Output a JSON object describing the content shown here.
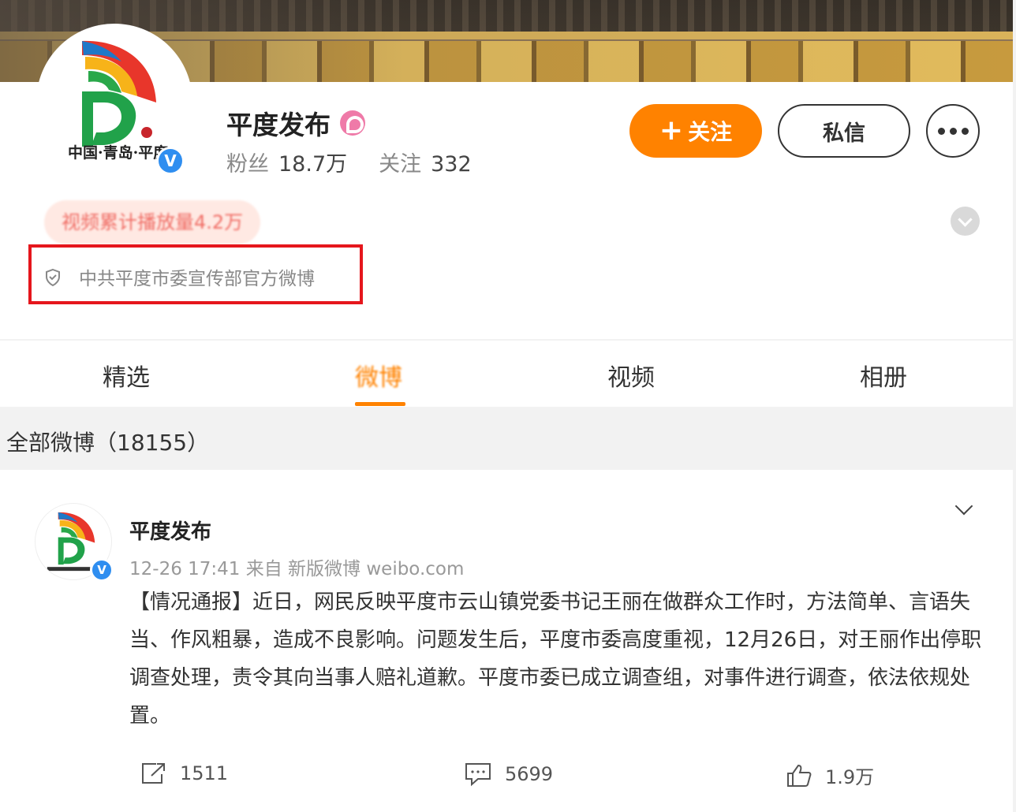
{
  "profile": {
    "name": "平度发布",
    "followers_label": "粉丝",
    "followers_value": "18.7万",
    "following_label": "关注",
    "following_value": "332",
    "follow_button": "关注",
    "message_button": "私信",
    "play_count_badge": "视频累计播放量4.2万",
    "description": "中共平度市委宣传部官方微博",
    "logo_text": "中国·青岛·平度",
    "verified_mark": "V"
  },
  "tabs": [
    "精选",
    "微博",
    "视频",
    "相册"
  ],
  "active_tab": "微博",
  "feed_title": "全部微博（18155）",
  "post": {
    "author": "平度发布",
    "meta": "12-26 17:41 来自 新版微博 weibo.com",
    "text": "【情况通报】近日，网民反映平度市云山镇党委书记王丽在做群众工作时，方法简单、言语失当、作风粗暴，造成不良影响。问题发生后，平度市委高度重视，12月26日，对王丽作出停职调查处理，责令其向当事人赔礼道歉。平度市委已成立调查组，对事件进行调查，依法依规处置。",
    "reposts": "1511",
    "comments": "5699",
    "likes": "1.9万"
  },
  "colors": {
    "accent": "#ff8200",
    "verified": "#2f8ef0",
    "highlight_border": "#e5161c"
  },
  "icons": [
    "shield-icon",
    "repost-icon",
    "comment-icon",
    "like-icon",
    "more-icon",
    "chevron-down-icon",
    "verified-icon"
  ]
}
